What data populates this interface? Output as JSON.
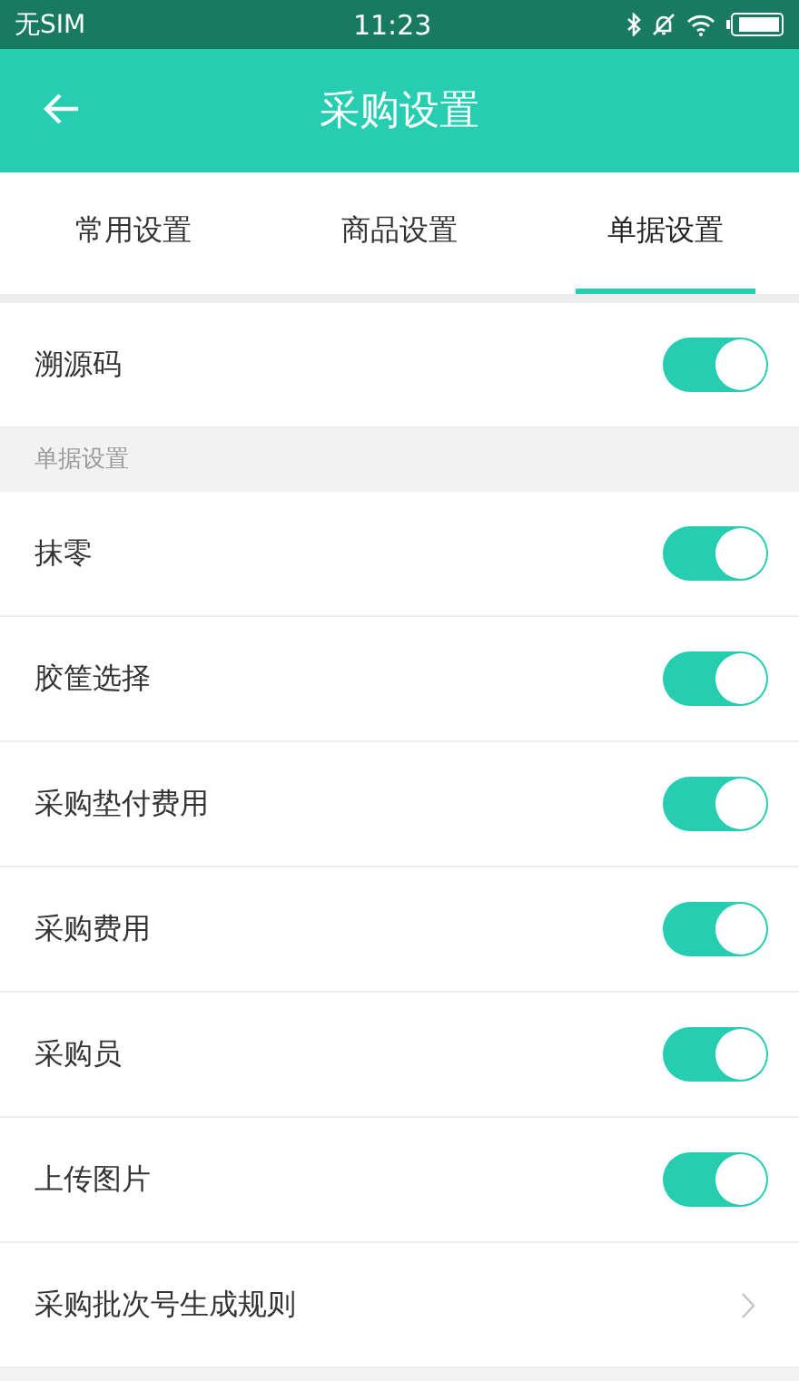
{
  "status_bar": {
    "carrier": "无SIM",
    "time": "11:23"
  },
  "header": {
    "title": "采购设置"
  },
  "tabs": [
    {
      "label": "常用设置",
      "selected": false
    },
    {
      "label": "商品设置",
      "selected": false
    },
    {
      "label": "单据设置",
      "selected": true
    }
  ],
  "sections": [
    {
      "items": [
        {
          "kind": "toggle",
          "label": "溯源码",
          "on": true
        }
      ]
    },
    {
      "heading": "单据设置",
      "items": [
        {
          "kind": "toggle",
          "label": "抹零",
          "on": true
        },
        {
          "kind": "toggle",
          "label": "胶筐选择",
          "on": true
        },
        {
          "kind": "toggle",
          "label": "采购垫付费用",
          "on": true
        },
        {
          "kind": "toggle",
          "label": "采购费用",
          "on": true
        },
        {
          "kind": "toggle",
          "label": "采购员",
          "on": true
        },
        {
          "kind": "toggle",
          "label": "上传图片",
          "on": true
        },
        {
          "kind": "link",
          "label": "采购批次号生成规则"
        }
      ]
    }
  ]
}
